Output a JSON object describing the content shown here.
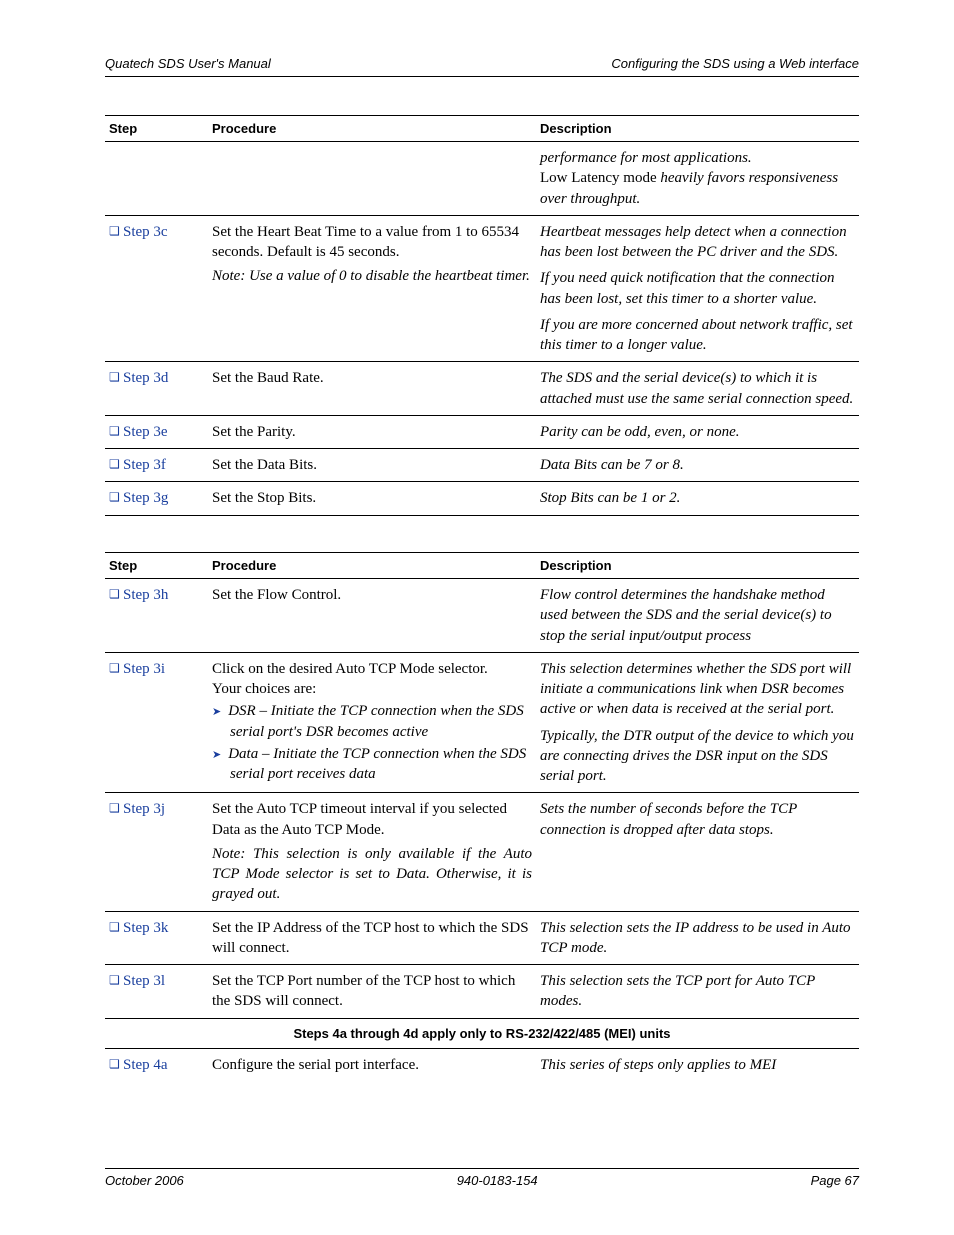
{
  "header": {
    "left": "Quatech SDS User's Manual",
    "right": "Configuring the SDS using a Web interface"
  },
  "columns": {
    "step": "Step",
    "procedure": "Procedure",
    "description": "Description"
  },
  "intro_desc_line1": "performance for most applications.",
  "intro_desc_line2a": "Low Latency mode ",
  "intro_desc_line2b": "heavily favors responsiveness over throughput.",
  "t1": [
    {
      "step": "Step 3c",
      "proc": "Set the Heart Beat Time to a value from 1 to 65534 seconds. Default is 45 seconds.",
      "proc_note": "Note: Use a value of 0 to disable the heartbeat timer.",
      "desc1": "Heartbeat messages help detect when a connection has been lost between the PC driver and the SDS.",
      "desc2": "If you need quick notification that the connection has been lost, set this timer to a shorter value.",
      "desc3": "If you are more concerned about network traffic, set this timer to a longer value."
    },
    {
      "step": "Step 3d",
      "proc": "Set the Baud Rate.",
      "desc1": "The SDS and the serial device(s) to which it is attached must use the same serial connection speed."
    },
    {
      "step": "Step 3e",
      "proc": "Set the Parity.",
      "desc1": "Parity can be odd, even, or none."
    },
    {
      "step": "Step 3f",
      "proc": "Set the Data Bits.",
      "desc1": "Data Bits can be 7 or 8."
    },
    {
      "step": "Step 3g",
      "proc": "Set the Stop Bits.",
      "desc1": "Stop Bits can be 1 or 2."
    }
  ],
  "t2": [
    {
      "step": "Step 3h",
      "proc": "Set the Flow Control.",
      "desc1": "Flow control determines the handshake method used between the SDS and the serial device(s) to stop the serial input/output process"
    },
    {
      "step": "Step 3i",
      "proc": "Click on the desired Auto TCP Mode selector.",
      "proc_extra": "Your choices are:",
      "subitems": [
        "DSR – Initiate the TCP connection when the SDS serial port's DSR becomes active",
        "Data – Initiate the TCP connection when the SDS serial port receives data"
      ],
      "desc1": "This selection determines whether the SDS port will initiate a communications link when DSR becomes active or when data is received at the serial port.",
      "desc2": "Typically, the DTR output of the device to which you are connecting drives the DSR input on the SDS serial port."
    },
    {
      "step": "Step 3j",
      "proc": "Set the Auto TCP timeout interval if you selected Data as the Auto TCP Mode.",
      "proc_note": "Note: This selection is only available if the Auto TCP Mode selector is set to Data. Otherwise, it is grayed out.",
      "desc1": "Sets the number of seconds before the TCP connection is dropped after data stops."
    },
    {
      "step": "Step 3k",
      "proc": "Set the IP Address of the TCP host to which the SDS will connect.",
      "desc1": "This selection sets the IP address to be used in Auto TCP mode."
    },
    {
      "step": "Step 3l",
      "proc": "Set the TCP Port number of the TCP host to which the SDS will connect.",
      "desc1": "This selection sets the TCP port for Auto TCP modes."
    }
  ],
  "section_note": "Steps 4a through 4d apply only to RS-232/422/485 (MEI) units",
  "t3": [
    {
      "step": "Step 4a",
      "proc": "Configure the serial port interface.",
      "desc1": "This series of steps only applies to MEI"
    }
  ],
  "footer": {
    "left": "October 2006",
    "center": "940-0183-154",
    "right": "Page 67"
  }
}
